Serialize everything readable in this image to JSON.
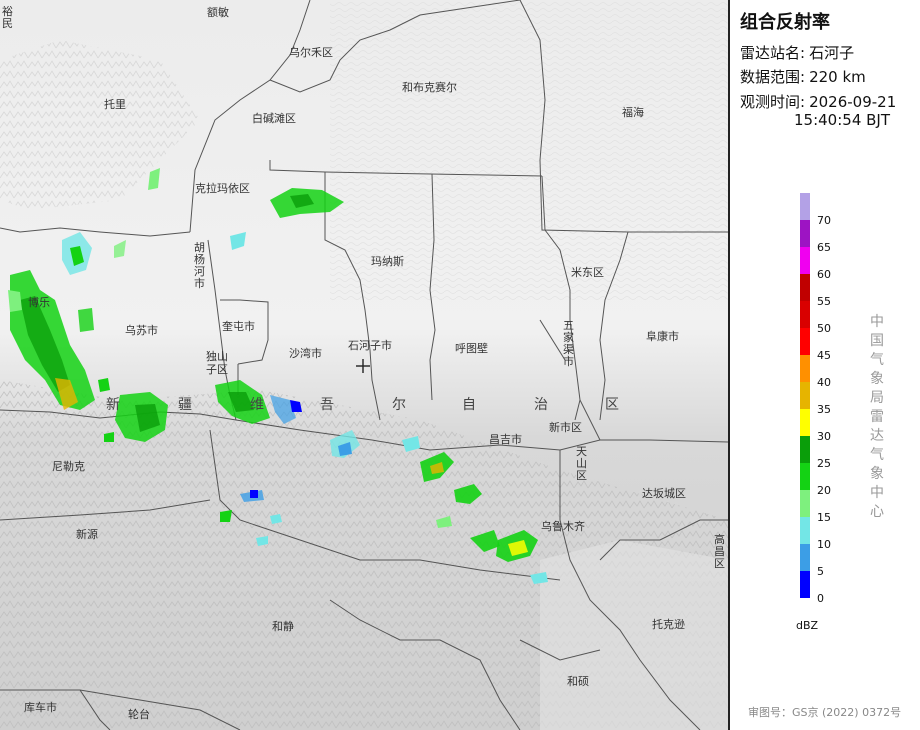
{
  "panel": {
    "title": "组合反射率",
    "station_key": "雷达站名:",
    "station_val": "石河子",
    "range_key": "数据范围:",
    "range_val": "220 km",
    "time_key": "观测时间:",
    "time_date": "2026-09-21",
    "time_clock": "15:40:54 BJT",
    "agency_vertical": "中国气象局雷达气象中心",
    "approval": "审图号：GS京 (2022) 0372号"
  },
  "legend": {
    "unit": "dBZ",
    "labels": [
      "70",
      "65",
      "60",
      "55",
      "50",
      "45",
      "40",
      "35",
      "30",
      "25",
      "20",
      "15",
      "10",
      "5",
      "0"
    ],
    "colors": [
      "#b3a1e6",
      "#9d14c3",
      "#f000f0",
      "#c00000",
      "#d90000",
      "#ff0000",
      "#ff9000",
      "#e6b400",
      "#ffff00",
      "#0a9e0a",
      "#14d214",
      "#7ef07e",
      "#73e6e6",
      "#3c9ee6",
      "#0000ff"
    ]
  },
  "map": {
    "places": {
      "p1": "额敏",
      "p2": "乌尔禾区",
      "p3": "和布克赛尔",
      "p4": "托里",
      "p5": "白碱滩区",
      "p6": "福海",
      "p7": "克拉玛依区",
      "p8": "胡杨河市",
      "p9": "玛纳斯",
      "p10": "米东区",
      "p11": "博乐",
      "p12": "乌苏市",
      "p13": "奎屯市",
      "p14": "独山子区",
      "p15": "沙湾市",
      "p16": "石河子市",
      "p17": "呼图壁",
      "p18": "五家渠市",
      "p19": "阜康市",
      "p20": "昌吉市",
      "p21": "新市区",
      "p22": "天山区",
      "p23": "尼勒克",
      "p24": "达坂城区",
      "p25": "乌鲁木齐",
      "p26": "新源",
      "p27": "高昌区",
      "p28": "和静",
      "p29": "托克逊",
      "p30": "和硕",
      "p31": "库车市",
      "p32": "轮台",
      "p33": "裕民"
    },
    "region_chars": [
      "新",
      "疆",
      "维",
      "吾",
      "尔",
      "自",
      "治",
      "区"
    ]
  }
}
